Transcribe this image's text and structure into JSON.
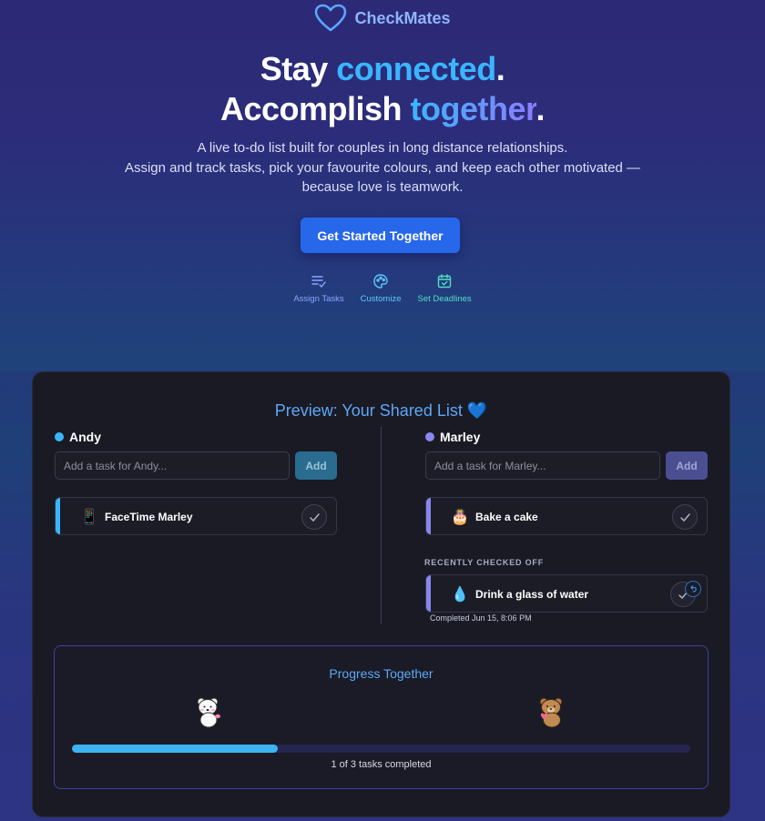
{
  "brand": {
    "name": "CheckMates",
    "color": "#8fb4ff"
  },
  "hero": {
    "headline_1a": "Stay ",
    "headline_1b": "connected",
    "headline_1c": ".",
    "headline_2a": "Accomplish ",
    "headline_2b": "together",
    "headline_2c": ".",
    "tagline_1": "A live to-do list built for couples in long distance relationships.",
    "tagline_2": "Assign and track tasks, pick your favourite colours, and keep each other motivated —",
    "tagline_3": "because love is teamwork.",
    "cta_label": "Get Started Together",
    "features": [
      {
        "label": "Assign Tasks",
        "icon": "list-check-icon"
      },
      {
        "label": "Customize",
        "icon": "palette-icon"
      },
      {
        "label": "Set Deadlines",
        "icon": "calendar-check-icon"
      }
    ]
  },
  "preview": {
    "title": "Preview: Your Shared List",
    "heart": "💙",
    "people": [
      {
        "name": "Andy",
        "color": "#3ab6ff",
        "input_placeholder": "Add a task for Andy...",
        "add_label": "Add",
        "tasks": [
          {
            "emoji": "📱",
            "label": "FaceTime Marley"
          }
        ]
      },
      {
        "name": "Marley",
        "color": "#8a86f0",
        "input_placeholder": "Add a task for Marley...",
        "add_label": "Add",
        "tasks": [
          {
            "emoji": "🎂",
            "label": "Bake a cake"
          }
        ],
        "recently_checked_label": "RECENTLY CHECKED OFF",
        "checked": [
          {
            "emoji": "💧",
            "label": "Drink a glass of water",
            "completed": "Completed Jun 15, 8:06 PM"
          }
        ]
      }
    ],
    "progress": {
      "title": "Progress Together",
      "fraction": 0.3333,
      "count_text": "1 of 3 tasks completed"
    }
  }
}
